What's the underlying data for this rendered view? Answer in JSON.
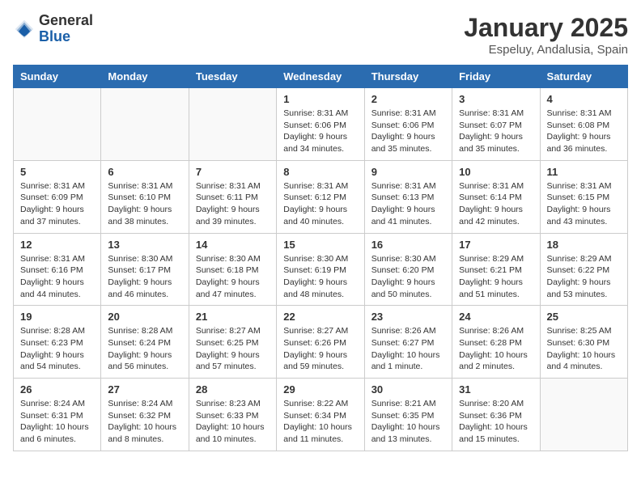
{
  "header": {
    "logo_general": "General",
    "logo_blue": "Blue",
    "month_title": "January 2025",
    "subtitle": "Espeluy, Andalusia, Spain"
  },
  "weekdays": [
    "Sunday",
    "Monday",
    "Tuesday",
    "Wednesday",
    "Thursday",
    "Friday",
    "Saturday"
  ],
  "weeks": [
    [
      {
        "day": "",
        "info": ""
      },
      {
        "day": "",
        "info": ""
      },
      {
        "day": "",
        "info": ""
      },
      {
        "day": "1",
        "info": "Sunrise: 8:31 AM\nSunset: 6:06 PM\nDaylight: 9 hours\nand 34 minutes."
      },
      {
        "day": "2",
        "info": "Sunrise: 8:31 AM\nSunset: 6:06 PM\nDaylight: 9 hours\nand 35 minutes."
      },
      {
        "day": "3",
        "info": "Sunrise: 8:31 AM\nSunset: 6:07 PM\nDaylight: 9 hours\nand 35 minutes."
      },
      {
        "day": "4",
        "info": "Sunrise: 8:31 AM\nSunset: 6:08 PM\nDaylight: 9 hours\nand 36 minutes."
      }
    ],
    [
      {
        "day": "5",
        "info": "Sunrise: 8:31 AM\nSunset: 6:09 PM\nDaylight: 9 hours\nand 37 minutes."
      },
      {
        "day": "6",
        "info": "Sunrise: 8:31 AM\nSunset: 6:10 PM\nDaylight: 9 hours\nand 38 minutes."
      },
      {
        "day": "7",
        "info": "Sunrise: 8:31 AM\nSunset: 6:11 PM\nDaylight: 9 hours\nand 39 minutes."
      },
      {
        "day": "8",
        "info": "Sunrise: 8:31 AM\nSunset: 6:12 PM\nDaylight: 9 hours\nand 40 minutes."
      },
      {
        "day": "9",
        "info": "Sunrise: 8:31 AM\nSunset: 6:13 PM\nDaylight: 9 hours\nand 41 minutes."
      },
      {
        "day": "10",
        "info": "Sunrise: 8:31 AM\nSunset: 6:14 PM\nDaylight: 9 hours\nand 42 minutes."
      },
      {
        "day": "11",
        "info": "Sunrise: 8:31 AM\nSunset: 6:15 PM\nDaylight: 9 hours\nand 43 minutes."
      }
    ],
    [
      {
        "day": "12",
        "info": "Sunrise: 8:31 AM\nSunset: 6:16 PM\nDaylight: 9 hours\nand 44 minutes."
      },
      {
        "day": "13",
        "info": "Sunrise: 8:30 AM\nSunset: 6:17 PM\nDaylight: 9 hours\nand 46 minutes."
      },
      {
        "day": "14",
        "info": "Sunrise: 8:30 AM\nSunset: 6:18 PM\nDaylight: 9 hours\nand 47 minutes."
      },
      {
        "day": "15",
        "info": "Sunrise: 8:30 AM\nSunset: 6:19 PM\nDaylight: 9 hours\nand 48 minutes."
      },
      {
        "day": "16",
        "info": "Sunrise: 8:30 AM\nSunset: 6:20 PM\nDaylight: 9 hours\nand 50 minutes."
      },
      {
        "day": "17",
        "info": "Sunrise: 8:29 AM\nSunset: 6:21 PM\nDaylight: 9 hours\nand 51 minutes."
      },
      {
        "day": "18",
        "info": "Sunrise: 8:29 AM\nSunset: 6:22 PM\nDaylight: 9 hours\nand 53 minutes."
      }
    ],
    [
      {
        "day": "19",
        "info": "Sunrise: 8:28 AM\nSunset: 6:23 PM\nDaylight: 9 hours\nand 54 minutes."
      },
      {
        "day": "20",
        "info": "Sunrise: 8:28 AM\nSunset: 6:24 PM\nDaylight: 9 hours\nand 56 minutes."
      },
      {
        "day": "21",
        "info": "Sunrise: 8:27 AM\nSunset: 6:25 PM\nDaylight: 9 hours\nand 57 minutes."
      },
      {
        "day": "22",
        "info": "Sunrise: 8:27 AM\nSunset: 6:26 PM\nDaylight: 9 hours\nand 59 minutes."
      },
      {
        "day": "23",
        "info": "Sunrise: 8:26 AM\nSunset: 6:27 PM\nDaylight: 10 hours\nand 1 minute."
      },
      {
        "day": "24",
        "info": "Sunrise: 8:26 AM\nSunset: 6:28 PM\nDaylight: 10 hours\nand 2 minutes."
      },
      {
        "day": "25",
        "info": "Sunrise: 8:25 AM\nSunset: 6:30 PM\nDaylight: 10 hours\nand 4 minutes."
      }
    ],
    [
      {
        "day": "26",
        "info": "Sunrise: 8:24 AM\nSunset: 6:31 PM\nDaylight: 10 hours\nand 6 minutes."
      },
      {
        "day": "27",
        "info": "Sunrise: 8:24 AM\nSunset: 6:32 PM\nDaylight: 10 hours\nand 8 minutes."
      },
      {
        "day": "28",
        "info": "Sunrise: 8:23 AM\nSunset: 6:33 PM\nDaylight: 10 hours\nand 10 minutes."
      },
      {
        "day": "29",
        "info": "Sunrise: 8:22 AM\nSunset: 6:34 PM\nDaylight: 10 hours\nand 11 minutes."
      },
      {
        "day": "30",
        "info": "Sunrise: 8:21 AM\nSunset: 6:35 PM\nDaylight: 10 hours\nand 13 minutes."
      },
      {
        "day": "31",
        "info": "Sunrise: 8:20 AM\nSunset: 6:36 PM\nDaylight: 10 hours\nand 15 minutes."
      },
      {
        "day": "",
        "info": ""
      }
    ]
  ]
}
